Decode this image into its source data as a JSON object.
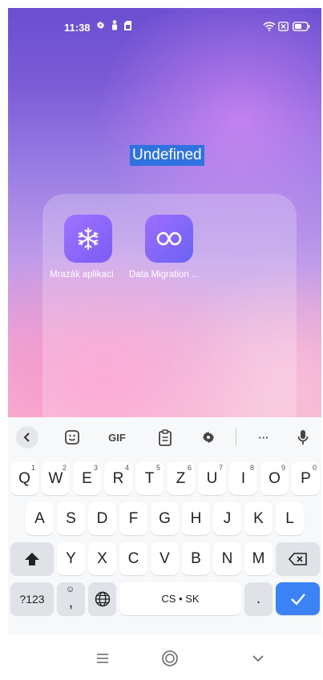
{
  "status": {
    "time": "11:38"
  },
  "folder": {
    "title": "Undefined",
    "apps": [
      {
        "label": "Mrazák aplikací",
        "icon": "snowflake-icon"
      },
      {
        "label": "Data Migration ...",
        "icon": "infinity-icon"
      }
    ]
  },
  "keyboard": {
    "toolbar": {
      "gif": "GIF",
      "more": "···"
    },
    "row1": [
      {
        "key": "Q",
        "num": "1"
      },
      {
        "key": "W",
        "num": "2"
      },
      {
        "key": "E",
        "num": "3"
      },
      {
        "key": "R",
        "num": "4"
      },
      {
        "key": "T",
        "num": "5"
      },
      {
        "key": "Z",
        "num": "6"
      },
      {
        "key": "U",
        "num": "7"
      },
      {
        "key": "I",
        "num": "8"
      },
      {
        "key": "O",
        "num": "9"
      },
      {
        "key": "P",
        "num": "0"
      }
    ],
    "row2": [
      "A",
      "S",
      "D",
      "F",
      "G",
      "H",
      "J",
      "K",
      "L"
    ],
    "row3": [
      "Y",
      "X",
      "C",
      "V",
      "B",
      "N",
      "M"
    ],
    "symbols_label": "?123",
    "comma_label": ",",
    "space_label": "CS • SK",
    "period_label": "."
  },
  "colors": {
    "accent": "#3b82f6",
    "selection": "#2f72e0"
  }
}
